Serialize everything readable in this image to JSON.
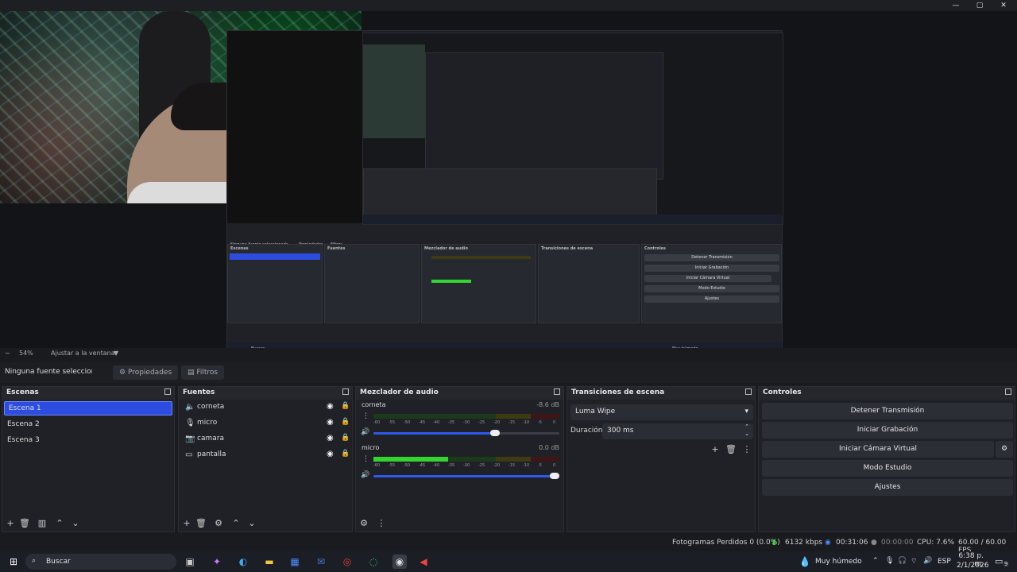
{
  "window": {
    "minimize": "—",
    "maximize": "▢",
    "close": "✕"
  },
  "preview": {
    "nested": {
      "source_none": "Ninguna fuente seleccionada",
      "props": "Propiedades",
      "filters": "Filtros",
      "scenes_title": "Escenas",
      "sources_title": "Fuentes",
      "mixer_title": "Mezclador de audio",
      "transitions_title": "Transiciones de escena",
      "controls_title": "Controles",
      "stop": "Detener Transmisión",
      "record": "Iniciar Grabación",
      "virtual": "Iniciar Cámara Virtual",
      "studio": "Modo Estudio",
      "settings": "Ajustes",
      "search": "Buscar",
      "weather": "Muy húmedo"
    }
  },
  "zoom": {
    "minus": "−",
    "value": "54%",
    "fit": "Ajustar a la ventana",
    "arrow": "▼"
  },
  "source_toolbar": {
    "selected": "Ninguna fuente seleccionada",
    "properties": "Propiedades",
    "filters": "Filtros"
  },
  "scenes": {
    "title": "Escenas",
    "items": [
      "Escena 1",
      "Escena 2",
      "Escena 3"
    ],
    "selected_index": 0
  },
  "sources": {
    "title": "Fuentes",
    "items": [
      {
        "label": "corneta",
        "icon": "speaker-icon"
      },
      {
        "label": "micro",
        "icon": "microphone-icon"
      },
      {
        "label": "camara",
        "icon": "camera-icon"
      },
      {
        "label": "pantalla",
        "icon": "monitor-icon"
      }
    ]
  },
  "mixer": {
    "title": "Mezclador de audio",
    "scale": [
      "-60",
      "-55",
      "-50",
      "-45",
      "-40",
      "-35",
      "-30",
      "-25",
      "-20",
      "-15",
      "-10",
      "-5",
      "0"
    ],
    "channels": [
      {
        "name": "corneta",
        "db": "-8.6 dB",
        "level": 0.0,
        "volume": 0.68
      },
      {
        "name": "micro",
        "db": "0.0 dB",
        "level": 0.4,
        "volume": 1.0
      }
    ]
  },
  "transitions": {
    "title": "Transiciones de escena",
    "type": "Luma Wipe",
    "duration_label": "Duración",
    "duration_value": "300 ms"
  },
  "controls": {
    "title": "Controles",
    "stop_stream": "Detener Transmisión",
    "start_record": "Iniciar Grabación",
    "start_virtualcam": "Iniciar Cámara Virtual",
    "studio_mode": "Modo Estudio",
    "settings": "Ajustes"
  },
  "status": {
    "dropped_frames": "Fotogramas Perdidos 0 (0.0%)",
    "bitrate": "6132 kbps",
    "stream_time": "00:31:06",
    "record_time": "00:00:00",
    "cpu": "CPU: 7.6%",
    "fps": "60.00 / 60.00 FPS"
  },
  "taskbar": {
    "search": "Buscar",
    "weather": "Muy húmedo",
    "lang": "ESP",
    "time": "6:38 p. m.",
    "date": "2/1/2026",
    "notif_count": "9"
  },
  "colors": {
    "accent": "#2d4de0",
    "meter_green": "#34d431",
    "bg": "#1a1b1f"
  }
}
